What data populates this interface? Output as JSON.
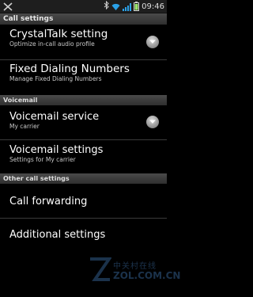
{
  "status_bar": {
    "time": "09:46"
  },
  "title": "Call settings",
  "sections": {
    "voicemail": "Voicemail",
    "other": "Other call settings"
  },
  "items": {
    "crystaltalk": {
      "title": "CrystalTalk setting",
      "subtitle": "Optimize in-call audio profile"
    },
    "fdn": {
      "title": "Fixed Dialing Numbers",
      "subtitle": "Manage Fixed Dialing Numbers"
    },
    "vm_service": {
      "title": "Voicemail service",
      "subtitle": "My carrier"
    },
    "vm_settings": {
      "title": "Voicemail settings",
      "subtitle": "Settings for My carrier"
    },
    "forwarding": {
      "title": "Call forwarding"
    },
    "additional": {
      "title": "Additional settings"
    }
  },
  "watermark": {
    "zh": "中关村在线",
    "en": "ZOL.COM.CN"
  },
  "icons": [
    "missed-call-icon",
    "bluetooth-icon",
    "wifi-icon",
    "signal-icon",
    "battery-icon",
    "chevron-down-icon"
  ]
}
